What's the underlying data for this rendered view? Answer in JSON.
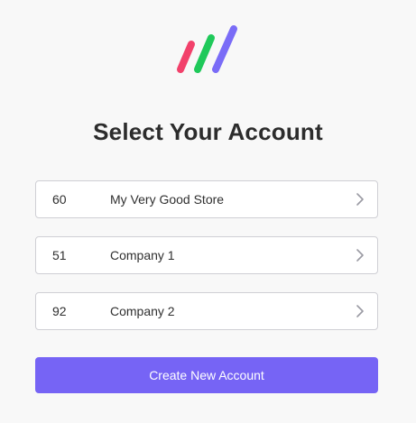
{
  "header": {
    "logo_icon": "three-diagonal-bars-logo",
    "logo_colors": [
      "#f2416b",
      "#1fc95a",
      "#7a6cf7"
    ],
    "title": "Select Your Account"
  },
  "accounts": [
    {
      "id": "60",
      "name": "My Very Good Store",
      "icon": "chevron-right-icon"
    },
    {
      "id": "51",
      "name": "Company 1",
      "icon": "chevron-right-icon"
    },
    {
      "id": "92",
      "name": "Company 2",
      "icon": "chevron-right-icon"
    }
  ],
  "actions": {
    "create_label": "Create New Account",
    "create_color": "#7664f5"
  }
}
